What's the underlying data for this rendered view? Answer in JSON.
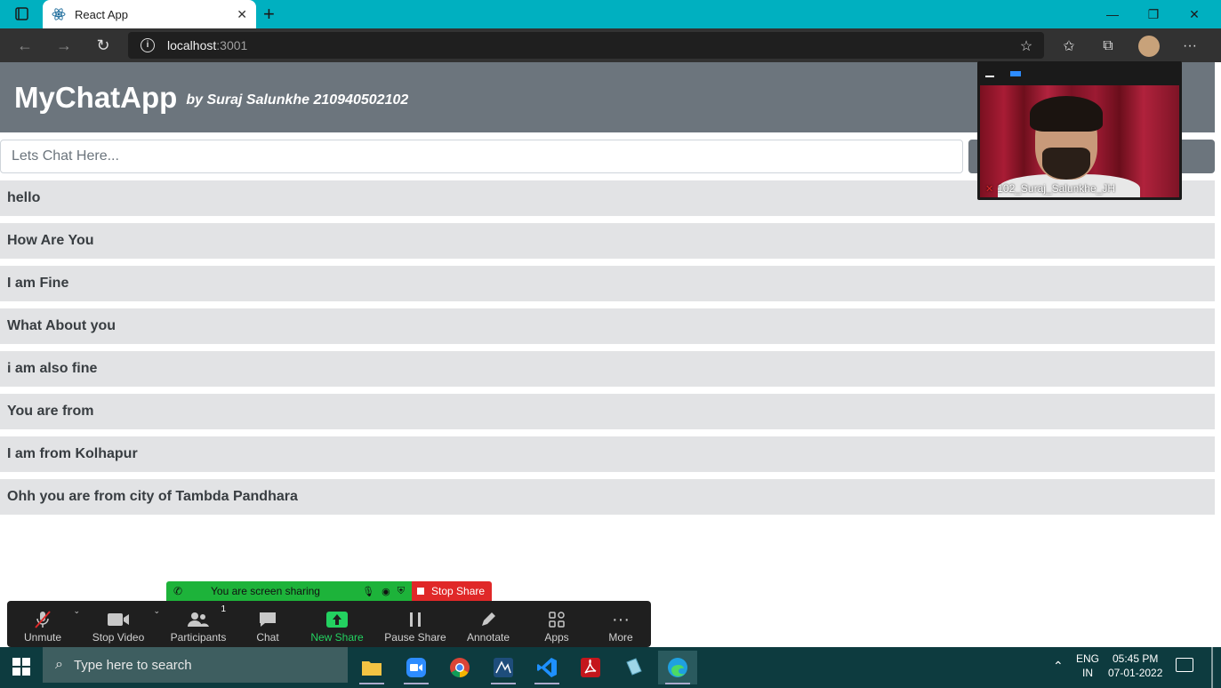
{
  "browser": {
    "tab_title": "React App",
    "url_host": "localhost",
    "url_port": ":3001"
  },
  "app": {
    "title": "MyChatApp",
    "subtitle": "by Suraj Salunkhe 210940502102",
    "input_placeholder": "Lets Chat Here...",
    "messages": [
      "hello",
      "How Are You",
      "I am Fine",
      "What About you",
      "i am also fine",
      "You are from",
      "I am from Kolhapur",
      "Ohh you are from city of Tambda Pandhara"
    ]
  },
  "zoom": {
    "video_name": "102_Suraj_Salunkhe_JH",
    "share_banner": "You are screen sharing",
    "stop_share": "Stop Share",
    "toolbar": [
      {
        "label": "Unmute",
        "icon": "mic-muted-icon"
      },
      {
        "label": "Stop Video",
        "icon": "video-camera-icon"
      },
      {
        "label": "Participants",
        "icon": "participants-icon",
        "count": "1"
      },
      {
        "label": "Chat",
        "icon": "chat-bubble-icon"
      },
      {
        "label": "New Share",
        "icon": "share-arrow-icon"
      },
      {
        "label": "Pause Share",
        "icon": "pause-icon"
      },
      {
        "label": "Annotate",
        "icon": "pencil-icon"
      },
      {
        "label": "Apps",
        "icon": "apps-icon"
      },
      {
        "label": "More",
        "icon": "ellipsis-icon"
      }
    ],
    "green_color": "#23d160",
    "stop_color": "#e02828"
  },
  "taskbar": {
    "search_placeholder": "Type here to search",
    "lang_top": "ENG",
    "lang_bottom": "IN",
    "time": "05:45 PM",
    "date": "07-01-2022"
  }
}
